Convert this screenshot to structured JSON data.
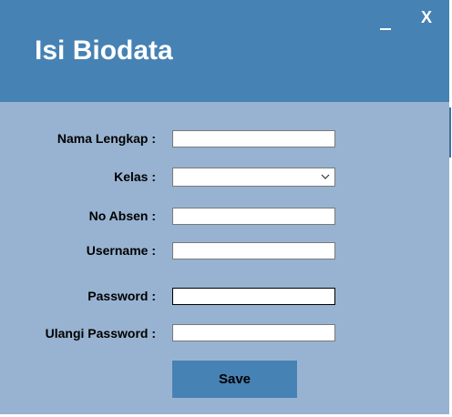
{
  "window": {
    "title": "Isi Biodata",
    "minimize_label": "_",
    "close_label": "X"
  },
  "form": {
    "nama_lengkap": {
      "label": "Nama Lengkap :",
      "value": ""
    },
    "kelas": {
      "label": "Kelas :",
      "selected": ""
    },
    "no_absen": {
      "label": "No Absen :",
      "value": ""
    },
    "username": {
      "label": "Username :",
      "value": ""
    },
    "password": {
      "label": "Password :",
      "value": ""
    },
    "ulangi_password": {
      "label": "Ulangi Password :",
      "value": ""
    },
    "save_label": "Save"
  },
  "colors": {
    "header": "#4682b4",
    "body": "#98b3d1",
    "button": "#4682b4"
  },
  "icons": {
    "kelas_dropdown": "chevron-down-icon"
  }
}
